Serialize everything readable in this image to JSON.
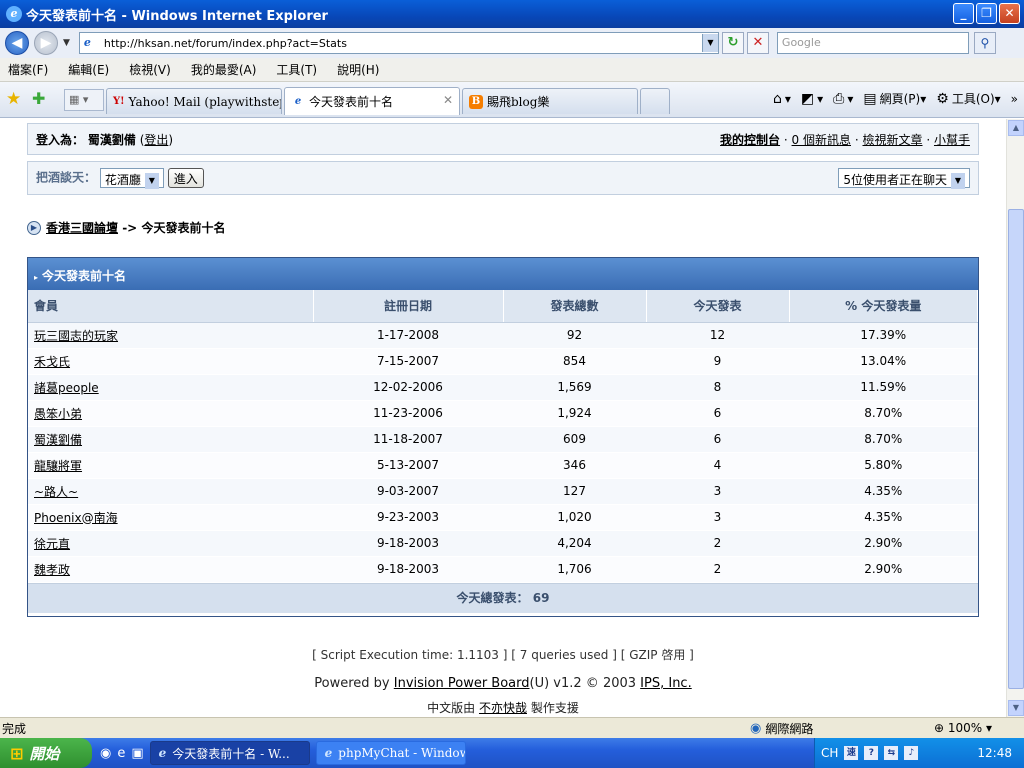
{
  "window": {
    "title": "今天發表前十名 - Windows Internet Explorer",
    "buttons": {
      "minimize": "_",
      "maximize": "❐",
      "close": "✕"
    }
  },
  "address_bar": {
    "url": "http://hksan.net/forum/index.php?act=Stats",
    "search_placeholder": "Google"
  },
  "menu": [
    "檔案(F)",
    "編輯(E)",
    "檢視(V)",
    "我的最愛(A)",
    "工具(T)",
    "說明(H)"
  ],
  "tabs": [
    {
      "label": "Yahoo! Mail (playwithstephen)",
      "icon": "yahoo-icon",
      "active": false
    },
    {
      "label": "今天發表前十名",
      "icon": "ie-page-icon",
      "active": true
    },
    {
      "label": "賜飛blog樂",
      "icon": "blogger-icon",
      "active": false
    }
  ],
  "command_bar": {
    "page_label": "網頁(P)",
    "tools_label": "工具(O)"
  },
  "userbar": {
    "login_label": "登入為：",
    "username": "蜀漢劉備",
    "logout_open": "(",
    "logout": "登出",
    "logout_close": ")",
    "control_panel": "我的控制台",
    "messages": "0 個新訊息",
    "new_posts": "檢視新文章",
    "helper": "小幫手",
    "sep": "·"
  },
  "chat": {
    "label": "把酒談天：",
    "room": "花酒廳",
    "go_button": "進入",
    "users_online": "5位使用者正在聊天"
  },
  "breadcrumb": {
    "forum": "香港三國論壇",
    "sep": "->",
    "current": "今天發表前十名"
  },
  "stats_table": {
    "title": "今天發表前十名",
    "columns": [
      "會員",
      "註冊日期",
      "發表總數",
      "今天發表",
      "% 今天發表量"
    ],
    "rows": [
      [
        "玩三國志的玩家",
        "1-17-2008",
        "92",
        "12",
        "17.39%"
      ],
      [
        "禾戈氏",
        "7-15-2007",
        "854",
        "9",
        "13.04%"
      ],
      [
        "諸葛people",
        "12-02-2006",
        "1,569",
        "8",
        "11.59%"
      ],
      [
        "愚笨小弟",
        "11-23-2006",
        "1,924",
        "6",
        "8.70%"
      ],
      [
        "蜀漢劉備",
        "11-18-2007",
        "609",
        "6",
        "8.70%"
      ],
      [
        "龍驤將軍",
        "5-13-2007",
        "346",
        "4",
        "5.80%"
      ],
      [
        "~路人~",
        "9-03-2007",
        "127",
        "3",
        "4.35%"
      ],
      [
        "Phoenix@南海",
        "9-23-2003",
        "1,020",
        "3",
        "4.35%"
      ],
      [
        "徐元直",
        "9-18-2003",
        "4,204",
        "2",
        "2.90%"
      ],
      [
        "魏孝政",
        "9-18-2003",
        "1,706",
        "2",
        "2.90%"
      ]
    ],
    "total_label": "今天總發表：",
    "total_value": "69"
  },
  "footer": {
    "exec_time": "[ Script Execution time: 1.1103 ]",
    "queries": "[ 7 queries used ]",
    "gzip": "[ GZIP 啓用 ]",
    "powered_prefix": "Powered by",
    "ipb_link": "Invision Power Board",
    "powered_version": "(U) v1.2 © 2003",
    "ips_link": "IPS, Inc.",
    "chinese_prefix": "中文版由",
    "chinese_link": "不亦快哉",
    "chinese_suffix": "製作支援"
  },
  "statusbar": {
    "status": "完成",
    "zone": "網際網路",
    "zoom": "100%"
  },
  "taskbar": {
    "start": "開始",
    "windows": [
      {
        "label": "今天發表前十名 - W...",
        "active": true
      },
      {
        "label": "phpMyChat - Window...",
        "active": false
      }
    ],
    "tray_lang": "CH",
    "clock": "12:48"
  },
  "colors": {
    "accent": "#3a6db4",
    "header_bg": "#dde6f1",
    "titlebar": "#0a5fd8"
  }
}
